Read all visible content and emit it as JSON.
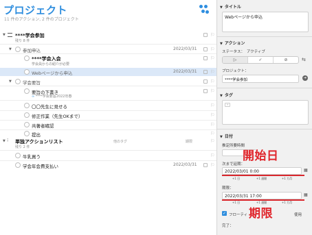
{
  "header": {
    "title": "プロジェクト",
    "subtitle": "11 件のアクション, 2 件のプロジェクト"
  },
  "rows": [
    {
      "id": "r1",
      "label": "****学会参加",
      "sub": "残り 8 件"
    },
    {
      "id": "r2",
      "label": "参加申込",
      "date": "2022/03/31"
    },
    {
      "id": "r3",
      "label": "****学会入会",
      "sub": "学会員からの紹介が必要"
    },
    {
      "id": "r4",
      "label": "Webページから申込",
      "date": "2022/03/31"
    },
    {
      "id": "r5",
      "label": "学会要旨"
    },
    {
      "id": "r6",
      "label": "要旨の下書き",
      "sub": "****学会要旨2022年春"
    },
    {
      "id": "r7",
      "label": "〇〇先生に見せる"
    },
    {
      "id": "r8",
      "label": "修正作業（先生OKまで）"
    },
    {
      "id": "r9",
      "label": "共著者確認"
    },
    {
      "id": "r10",
      "label": "提出"
    },
    {
      "id": "r11",
      "label": "単独アクションリスト",
      "sub": "残り 2 件",
      "tag": "他のタグ",
      "extra": "期限"
    },
    {
      "id": "r12",
      "label": "牛乳買う"
    },
    {
      "id": "r13",
      "label": "学会年会費支払い",
      "date": "2022/03/31"
    }
  ],
  "inspector": {
    "title_section": "タイトル",
    "title_value": "Webページから申込",
    "action_section": "アクション",
    "status_label": "ステータス：",
    "status_value": "アクティブ",
    "project_label": "プロジェクト：",
    "project_value": "****学会参加",
    "tag_section": "タグ",
    "date_section": "日付",
    "estimate_label": "推定所要時間",
    "defer_label": "次まで延期：",
    "defer_value": "2022/03/01 0:00",
    "due_label": "期限：",
    "due_value": "2022/03/31 17:00",
    "quick": [
      "+1 日",
      "+1 週間",
      "+1 カ月"
    ],
    "floating_label": "フローティ",
    "floating_tail": "使用",
    "complete_label": "完了："
  },
  "annotations": {
    "start": "開始日",
    "due": "期限"
  },
  "colors": {
    "accent": "#2f8ede",
    "annotation": "#e0262c",
    "selection": "#dbe8f8"
  }
}
